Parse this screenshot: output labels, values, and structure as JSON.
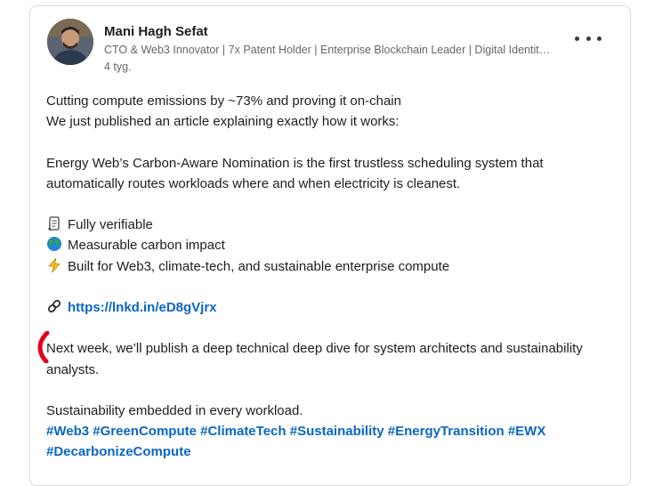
{
  "author": {
    "name": "Mani Hagh Sefat",
    "headline": "CTO & Web3 Innovator | 7x Patent Holder | Enterprise Blockchain Leader | Digital Identit…",
    "age": "4 tyg."
  },
  "icons": {
    "more": "more-horizontal-icon",
    "scroll": "scroll-icon",
    "globe": "globe-icon",
    "lightning": "lightning-icon",
    "link": "link-icon"
  },
  "colors": {
    "link": "#0a66c2",
    "annotation": "#e3001b"
  },
  "post": {
    "line1": "Cutting compute emissions by ~73% and proving it on-chain",
    "line2": "We just published an article explaining exactly how it works:",
    "para2": "Energy Web’s Carbon-Aware Nomination is the first trustless scheduling system that automatically routes workloads where and when electricity is cleanest.",
    "features": [
      "Fully verifiable",
      "Measurable carbon impact",
      "Built for Web3, climate-tech, and sustainable enterprise compute"
    ],
    "link": "https://lnkd.in/eD8gVjrx",
    "para4": "Next week, we’ll publish a deep technical deep dive for system architects and sustainability analysts.",
    "closing": "Sustainability embedded in every workload.",
    "hashtags": [
      "#Web3",
      "#GreenCompute",
      "#ClimateTech",
      "#Sustainability",
      "#EnergyTransition",
      "#EWX",
      "#DecarbonizeCompute"
    ]
  }
}
